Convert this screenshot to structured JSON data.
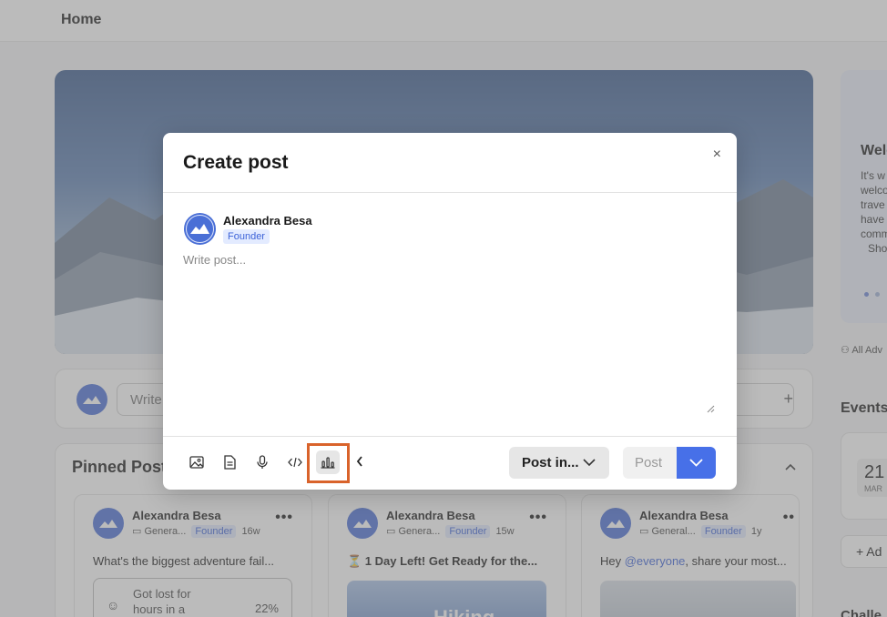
{
  "page": {
    "title": "Home"
  },
  "composer": {
    "placeholder": "Write"
  },
  "pinned": {
    "title": "Pinned Posts",
    "cards": [
      {
        "author": "Alexandra Besa",
        "channel": "Genera...",
        "role": "Founder",
        "age": "16w",
        "text": "What's the biggest adventure fail...",
        "poll": {
          "option": "Got lost for hours in a",
          "percent": "22%"
        }
      },
      {
        "author": "Alexandra Besa",
        "channel": "Genera...",
        "role": "Founder",
        "age": "15w",
        "text": "⏳ 1 Day Left! Get Ready for the...",
        "image_text": "Hiking"
      },
      {
        "author": "Alexandra Besa",
        "channel": "General...",
        "role": "Founder",
        "age": "1y",
        "text_prefix": "Hey ",
        "mention": "@everyone",
        "text_suffix": ", share your most..."
      }
    ]
  },
  "sidebar": {
    "welcome_title": "Welcome",
    "welcome_text": "It's w... welco... trave... have... comm...",
    "welcome_lines": [
      "It's w",
      "welco",
      "trave",
      "have",
      "comm"
    ],
    "show_more": "Sho",
    "members_link": "All Adv",
    "events_title": "Events",
    "event_day": "21",
    "event_month": "MAR",
    "add_label": "Ad",
    "challenges_title": "Challe"
  },
  "modal": {
    "title": "Create post",
    "close_label": "×",
    "user_name": "Alexandra Besa",
    "user_role": "Founder",
    "post_placeholder": "Write post...",
    "post_in_label": "Post in...",
    "post_label": "Post",
    "toolbar_icons": [
      "image-icon",
      "document-icon",
      "microphone-icon",
      "code-icon",
      "poll-chart-icon",
      "chevron-left-icon"
    ],
    "highlighted_tool": "poll-chart-icon"
  },
  "colors": {
    "accent": "#4770e8",
    "badge_bg": "#e3ebff",
    "badge_text": "#3d63d8",
    "highlight_border": "#d9632b"
  }
}
